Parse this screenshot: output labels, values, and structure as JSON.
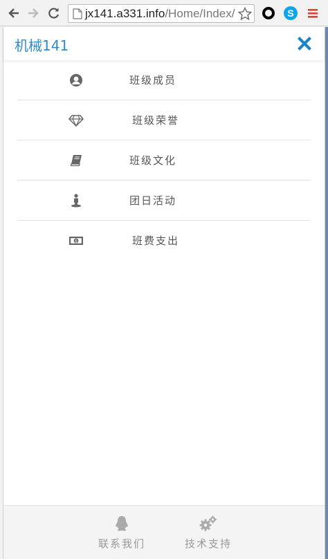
{
  "browser": {
    "url_host": "jx141.a331.info",
    "url_path": "/Home/Index/"
  },
  "header": {
    "title": "机械141"
  },
  "menu": [
    {
      "label": "班级成员",
      "icon": "user-circle-icon"
    },
    {
      "label": "班级荣誉",
      "icon": "diamond-icon"
    },
    {
      "label": "班级文化",
      "icon": "book-icon"
    },
    {
      "label": "团日活动",
      "icon": "street-view-icon"
    },
    {
      "label": "班费支出",
      "icon": "money-icon"
    }
  ],
  "footer": {
    "contact_label": "联系我们",
    "support_label": "技术支持"
  },
  "colors": {
    "brand": "#2f8cc9",
    "menu_text": "#555555",
    "footer_text": "#999999"
  }
}
